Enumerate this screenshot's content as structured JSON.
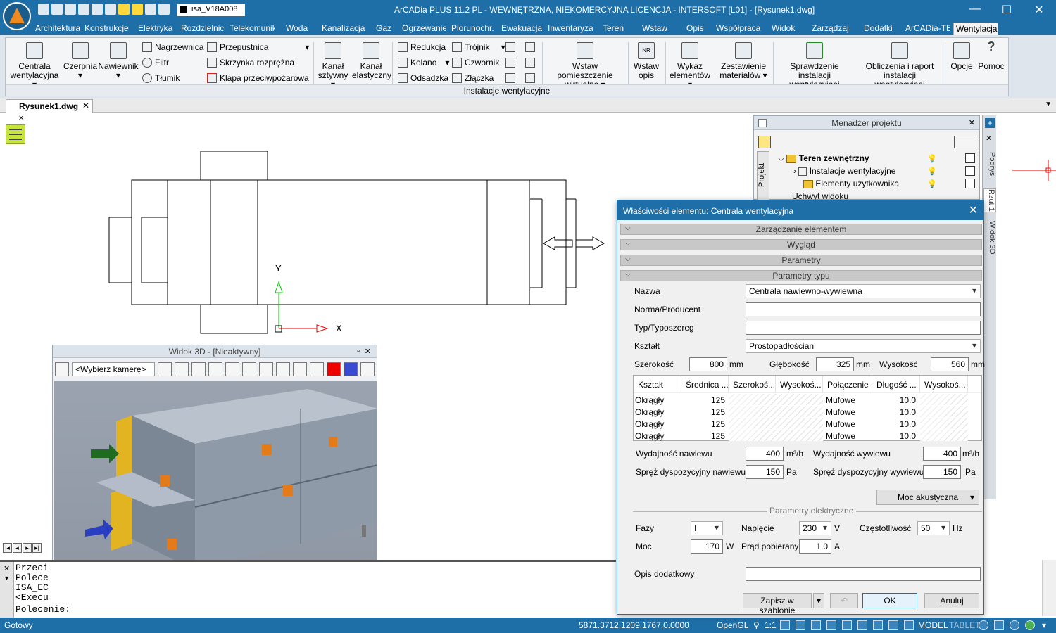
{
  "titlebar": {
    "layer_name": "isa_V18A008",
    "title": "ArCADia PLUS 11.2 PL - WEWNĘTRZNA, NIEKOMERCYJNA LICENCJA - INTERSOFT [L01] - [Rysunek1.dwg]",
    "minimize": "—",
    "maximize": "☐",
    "close": "✕"
  },
  "tabs": [
    "Architektura",
    "Konstrukcje",
    "Elektryka",
    "Rozdzielnice",
    "Telekomunik",
    "Woda",
    "Kanalizacja",
    "Gaz",
    "Ogrzewanie",
    "Piorunochr.",
    "Ewakuacja",
    "Inwentaryza",
    "Teren",
    "Wstaw",
    "Opis",
    "Współpraca",
    "Widok",
    "Zarządzaj",
    "Dodatki",
    "ArCADia-TEF",
    "Wentylacja"
  ],
  "ribbon": {
    "group_label": "Instalacje wentylacyjne",
    "centrala_l1": "Centrala",
    "centrala_l2": "wentylacyjna ▾",
    "czerpnia": "Czerpnia",
    "czerpnia_arrow": "▾",
    "nawiewnik": "Nawiewnik",
    "nawiewnik_arrow": "▾",
    "nagrzewnica": "Nagrzewnica",
    "filtr": "Filtr",
    "tlumik": "Tłumik",
    "przepustnica": "Przepustnica",
    "przepustnica_arrow": "▾",
    "skrzynka": "Skrzynka rozprężna",
    "klapa": "Klapa przeciwpożarowa",
    "kanal_sztywny_l1": "Kanał",
    "kanal_sztywny_l2": "sztywny ▾",
    "kanal_elastyczny_l1": "Kanał",
    "kanal_elastyczny_l2": "elastyczny",
    "redukcja": "Redukcja",
    "kolano": "Kolano",
    "kolano_arrow": "▾",
    "odsadzka": "Odsadzka",
    "trojnik": "Trójnik",
    "trojnik_arrow": "▾",
    "czwornik": "Czwórnik",
    "zlaczka": "Złączka",
    "wstaw_pom_l1": "Wstaw pomieszczenie",
    "wstaw_pom_l2": "wirtualne ▾",
    "wstaw_opis_l1": "Wstaw",
    "wstaw_opis_l2": "opis",
    "nr_badge": "NR",
    "wykaz_l1": "Wykaz",
    "wykaz_l2": "elementów ▾",
    "zestawienie_l1": "Zestawienie",
    "zestawienie_l2": "materiałów ▾",
    "sprawdzenie_l1": "Sprawdzenie instalacji",
    "sprawdzenie_l2": "wentylacyjnej",
    "obliczenia_l1": "Obliczenia i raport",
    "obliczenia_l2": "instalacji wentylacyjnej",
    "opcje": "Opcje",
    "pomoc": "Pomoc",
    "pomoc_glyph": "?"
  },
  "doc_tab": {
    "name": "Rysunek1.dwg",
    "close": "✕"
  },
  "ucs": {
    "x": "X",
    "y": "Y"
  },
  "project_manager": {
    "title": "Menadżer projektu",
    "close": "✕",
    "side_tab": "Projekt",
    "items": [
      "Teren zewnętrzny",
      "Instalacje wentylacyjne",
      "Elementy użytkownika",
      "Uchwyt widoku"
    ]
  },
  "side_tabs": [
    "Podrys",
    "Rzut 1",
    "Widok 3D"
  ],
  "view3d": {
    "title": "Widok 3D - [Nieaktywny]",
    "camera": "<Wybierz kamerę>"
  },
  "command": {
    "lines": [
      "Przeci",
      "Polece",
      "ISA_EC",
      "<Execu"
    ],
    "prompt": "Polecenie:"
  },
  "status": {
    "ready": "Gotowy",
    "coords": "5871.3712,1209.1767,0.0000",
    "renderer": "OpenGL",
    "scale": "1:1",
    "model": "MODEL",
    "tablet": "TABLET"
  },
  "dialog": {
    "title": "Właściwości elementu: Centrala wentylacyjna",
    "close": "✕",
    "sections": [
      "Zarządzanie elementem",
      "Wygląd",
      "Parametry",
      "Parametry typu"
    ],
    "nazwa_label": "Nazwa",
    "nazwa_value": "Centrala nawiewno-wywiewna",
    "norma_label": "Norma/Producent",
    "norma_value": "",
    "typ_label": "Typ/Typoszereg",
    "typ_value": "",
    "ksztalt_label": "Kształt",
    "ksztalt_value": "Prostopadłościan",
    "szer_label": "Szerokość",
    "szer_value": "800",
    "gleb_label": "Głębokość",
    "gleb_value": "325",
    "wys_label": "Wysokość",
    "wys_value": "560",
    "mm": "mm",
    "grid_headers": [
      "Kształt",
      "Średnica ...",
      "Szerokoś...",
      "Wysokoś...",
      "Połączenie",
      "Długość ...",
      "Wysokoś..."
    ],
    "grid_rows": [
      [
        "Okrągły",
        "125",
        "",
        "",
        "Mufowe",
        "10.0",
        ""
      ],
      [
        "Okrągły",
        "125",
        "",
        "",
        "Mufowe",
        "10.0",
        ""
      ],
      [
        "Okrągły",
        "125",
        "",
        "",
        "Mufowe",
        "10.0",
        ""
      ],
      [
        "Okrągły",
        "125",
        "",
        "",
        "Mufowe",
        "10.0",
        ""
      ]
    ],
    "wyd_naw_label": "Wydajność nawiewu",
    "wyd_naw_value": "400",
    "wyd_wyw_label": "Wydajność wywiewu",
    "wyd_wyw_value": "400",
    "m3h": "m³/h",
    "spr_naw_label": "Spręż dyspozycyjny nawiewu",
    "spr_naw_value": "150",
    "spr_wyw_label": "Spręż dyspozycyjny wywiewu",
    "spr_wyw_value": "150",
    "pa": "Pa",
    "moc_akust": "Moc akustyczna",
    "moc_akust_arrow": "▾",
    "elec_title": "Parametry elektryczne",
    "fazy_label": "Fazy",
    "fazy_value": "I",
    "napiecie_label": "Napięcie",
    "napiecie_value": "230",
    "v_unit": "V",
    "czest_label": "Częstotliwość",
    "czest_value": "50",
    "hz_unit": "Hz",
    "moc_label": "Moc",
    "moc_value": "170",
    "w_unit": "W",
    "prad_label": "Prąd pobierany",
    "prad_value": "1.0",
    "a_unit": "A",
    "opis_label": "Opis dodatkowy",
    "opis_value": "",
    "btn_template": "Zapisz w szablonie",
    "btn_template_arrow": "▾",
    "btn_ok": "OK",
    "btn_cancel": "Anuluj"
  }
}
